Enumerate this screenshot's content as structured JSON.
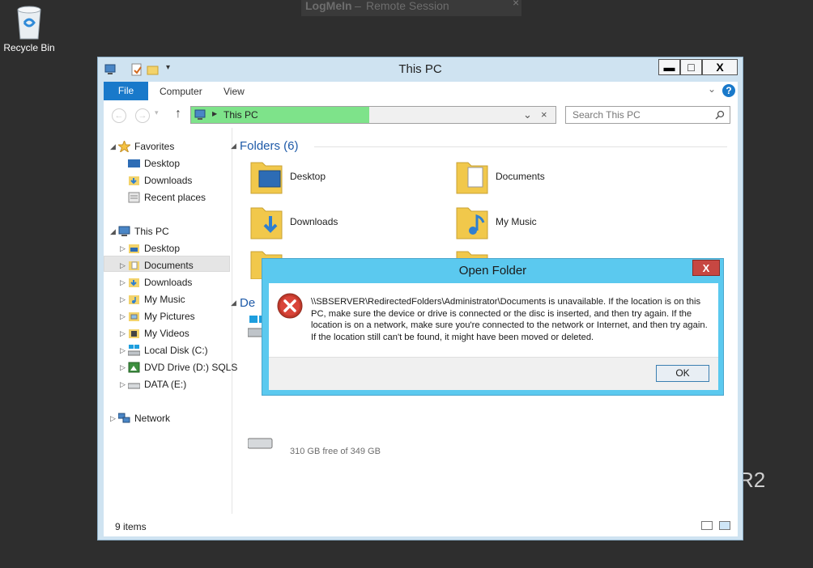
{
  "remote_bar": {
    "brand": "LogMeIn",
    "separator": "–",
    "session": "Remote Session",
    "close": "×"
  },
  "desktop": {
    "recycle_bin_label": "Recycle Bin",
    "wallpaper_text": "R2"
  },
  "window": {
    "title": "This PC",
    "caption_buttons": {
      "minimize": "▬",
      "maximize": "□",
      "close": "X"
    }
  },
  "ribbon": {
    "tabs": [
      {
        "label": "File"
      },
      {
        "label": "Computer"
      },
      {
        "label": "View"
      }
    ],
    "help": "?"
  },
  "address_bar": {
    "path": "This PC",
    "search_placeholder": "Search This PC"
  },
  "nav_pane": {
    "favorites": {
      "label": "Favorites",
      "items": [
        {
          "label": "Desktop"
        },
        {
          "label": "Downloads"
        },
        {
          "label": "Recent places"
        }
      ]
    },
    "this_pc": {
      "label": "This PC",
      "items": [
        {
          "label": "Desktop"
        },
        {
          "label": "Documents"
        },
        {
          "label": "Downloads"
        },
        {
          "label": "My Music"
        },
        {
          "label": "My Pictures"
        },
        {
          "label": "My Videos"
        },
        {
          "label": "Local Disk (C:)"
        },
        {
          "label": "DVD Drive (D:) SQLS"
        },
        {
          "label": "DATA (E:)"
        }
      ]
    },
    "network": {
      "label": "Network"
    },
    "selected": "Documents"
  },
  "main": {
    "group_title": "Folders (6)",
    "partial_group_title": "De",
    "folders": [
      {
        "label": "Desktop"
      },
      {
        "label": "Documents"
      },
      {
        "label": "Downloads"
      },
      {
        "label": "My Music"
      }
    ],
    "partial_drive_text": "310 GB free of 349 GB"
  },
  "status_bar": {
    "item_count": "9 items"
  },
  "dialog": {
    "title": "Open Folder",
    "close": "X",
    "message": "\\\\SBSERVER\\RedirectedFolders\\Administrator\\Documents is unavailable. If the location is on this PC, make sure the device or drive is connected or the disc is inserted, and then try again. If the location is on a network, make sure you're connected to the network or Internet, and then try again. If the location still can't be found, it might have been moved or deleted.",
    "ok_label": "OK"
  },
  "colors": {
    "file_tab": "#1979ca",
    "address_progress": "#7ee38a",
    "dialog_frame": "#5bc9ef",
    "dialog_close": "#c74742",
    "group_header": "#1e5aa8"
  }
}
